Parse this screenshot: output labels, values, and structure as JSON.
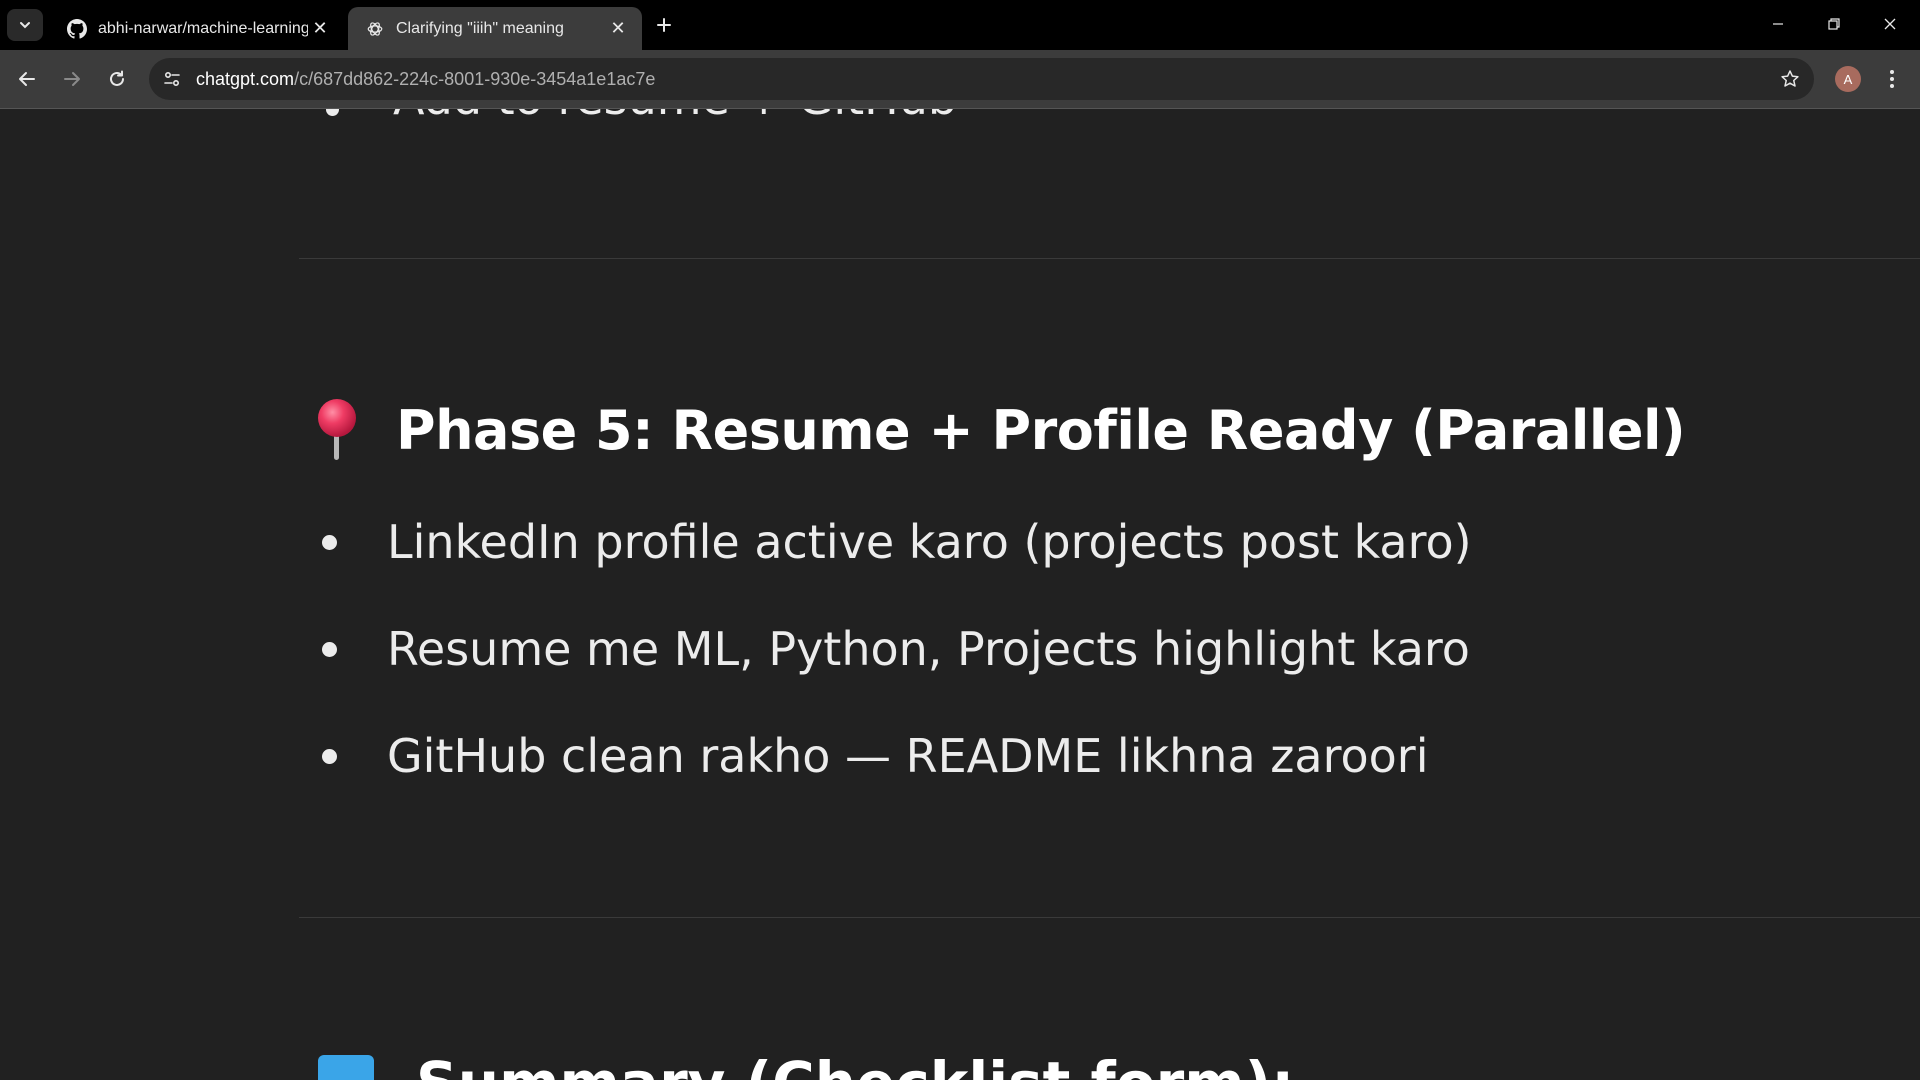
{
  "tabs": [
    {
      "title": "abhi-narwar/machine-learning",
      "icon": "github-icon",
      "active": false
    },
    {
      "title": "Clarifying \"iiih\" meaning",
      "icon": "chatgpt-icon",
      "active": true
    }
  ],
  "toolbar": {
    "url_host": "chatgpt.com",
    "url_path": "/c/687dd862-224c-8001-930e-3454a1e1ac7e",
    "avatar_letter": "A"
  },
  "content": {
    "partial_top_text": "Add to resume + GitHub",
    "phase_heading": {
      "emoji": "round-pushpin",
      "text": "Phase 5: Resume + Profile Ready (Parallel)"
    },
    "bullets": [
      "LinkedIn profile active karo (projects post karo)",
      "Resume me ML, Python, Projects highlight karo",
      "GitHub clean rakho — README likhna zaroori"
    ],
    "bottom_heading": {
      "emoji": "blue-square",
      "text": "Summary (Checklist form):"
    }
  },
  "colors": {
    "page_bg": "#212121",
    "tabstrip_bg": "#000000",
    "toolbar_bg": "#3c3c3c",
    "text": "#ececec",
    "pin_red": "#e8365a",
    "blue_square": "#3aa5e8"
  }
}
